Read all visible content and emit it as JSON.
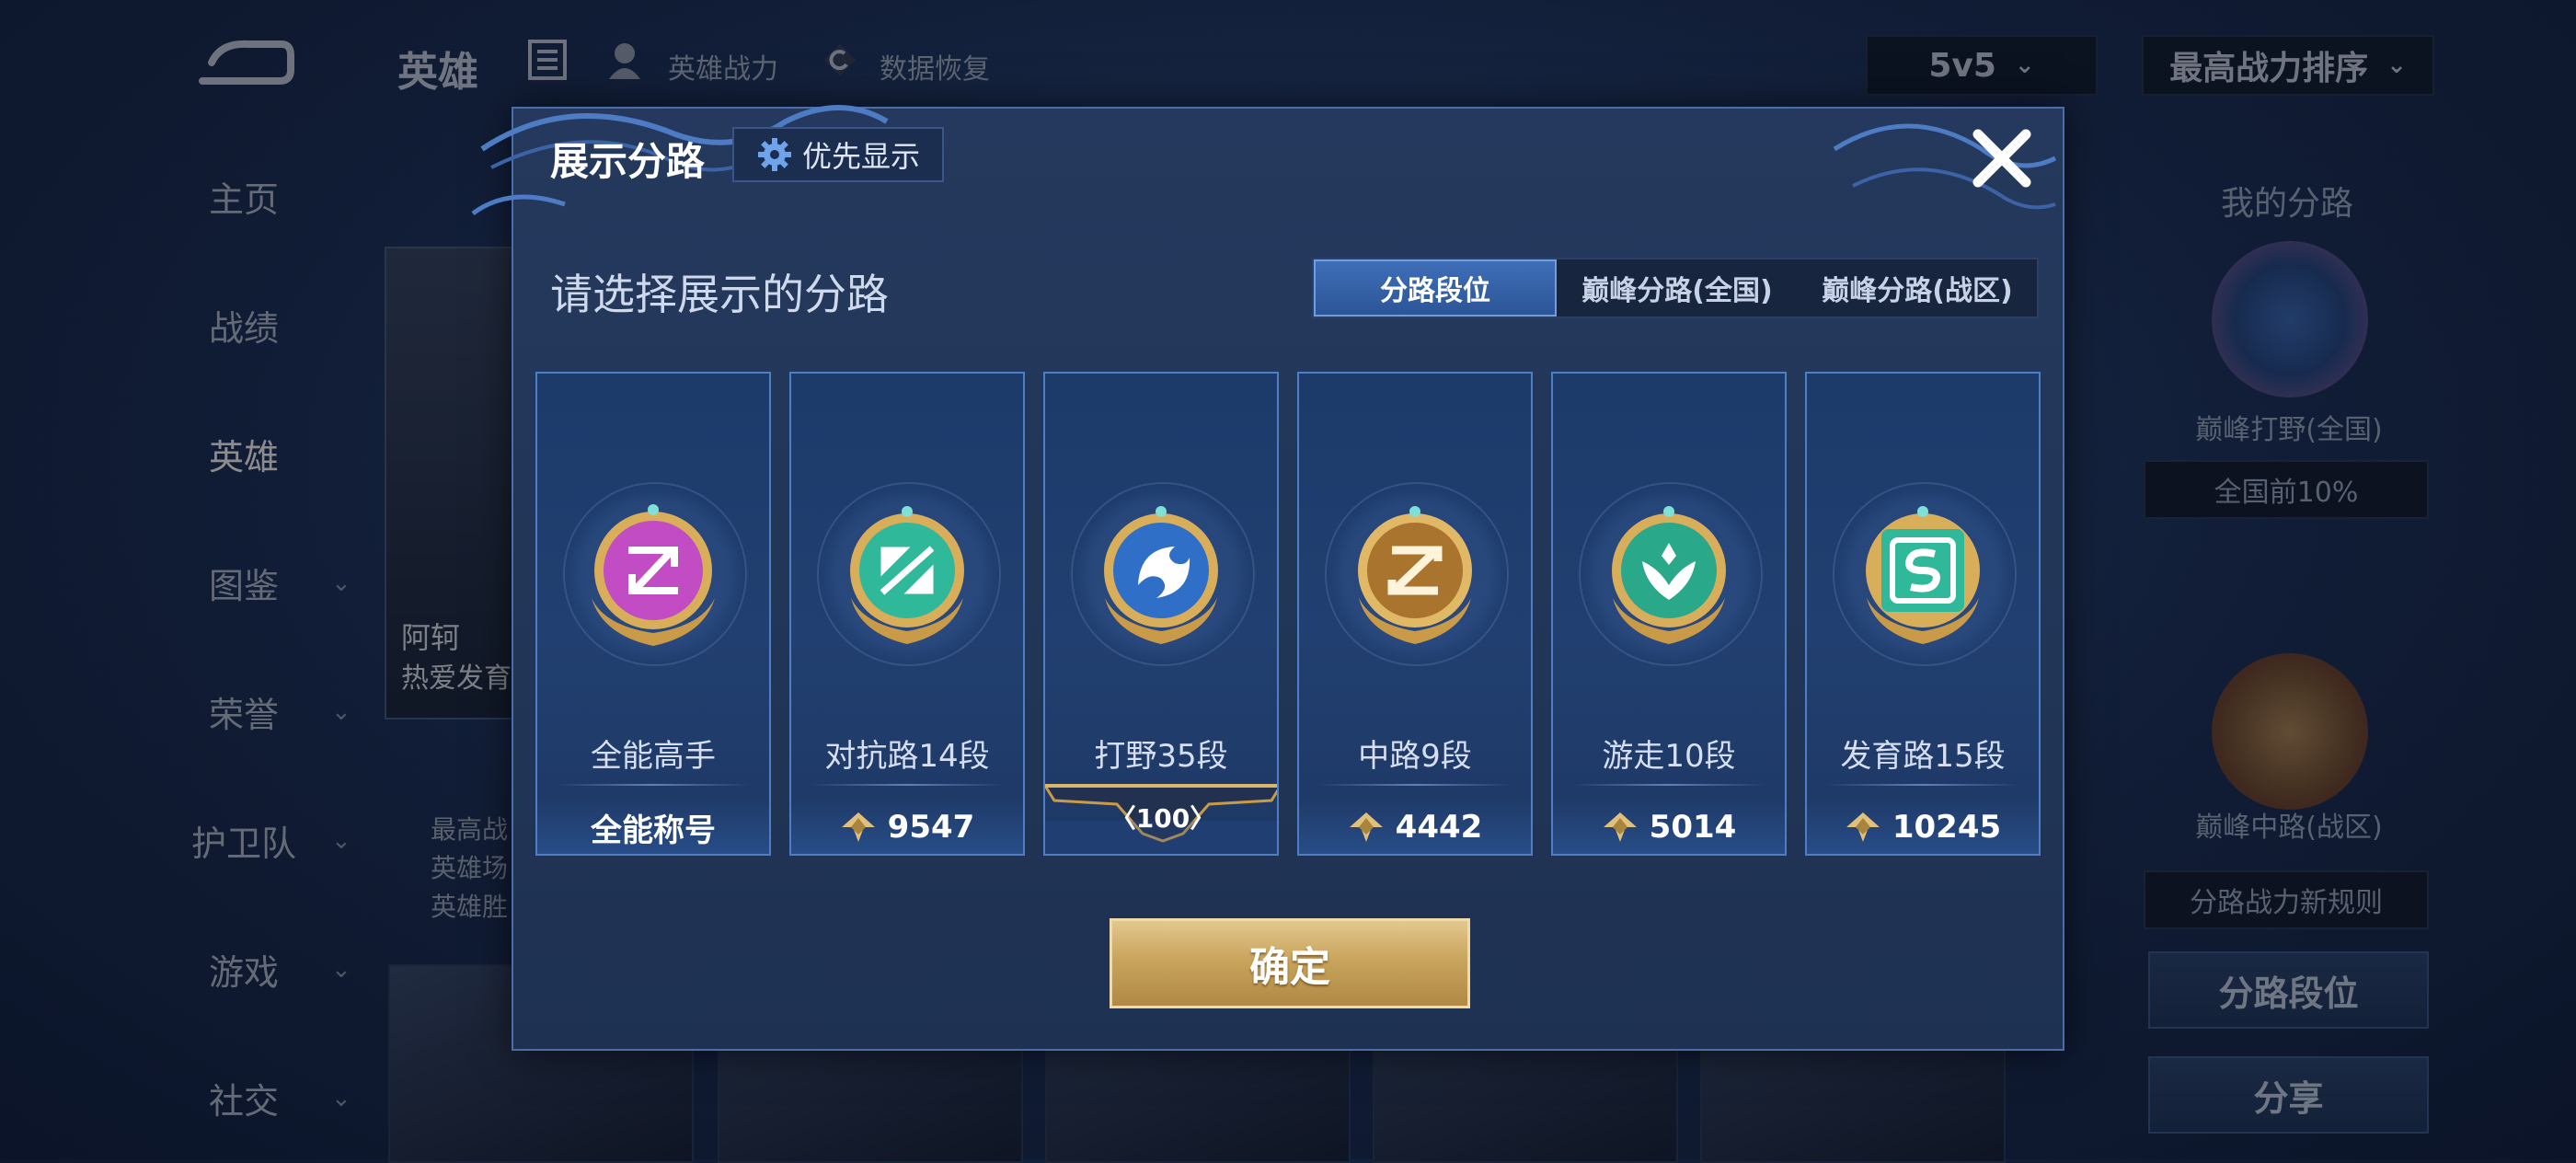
{
  "background": {
    "top_bar": {
      "title": "英雄",
      "links": [
        "英雄战力",
        "数据恢复"
      ],
      "mode_select": "5v5",
      "sort_select": "最高战力排序"
    },
    "sidebar": {
      "items": [
        {
          "label": "主页",
          "has_chevron": false
        },
        {
          "label": "战绩",
          "has_chevron": false
        },
        {
          "label": "英雄",
          "has_chevron": false,
          "active": true
        },
        {
          "label": "图鉴",
          "has_chevron": true
        },
        {
          "label": "荣誉",
          "has_chevron": true
        },
        {
          "label": "护卫队",
          "has_chevron": true
        },
        {
          "label": "游戏",
          "has_chevron": true
        },
        {
          "label": "社交",
          "has_chevron": true
        }
      ]
    },
    "hero_card": {
      "name_partial": "阿轲",
      "subtitle_partial": "热爱发育",
      "meta": [
        "最高战",
        "英雄场",
        "英雄胜"
      ]
    },
    "right_panel": {
      "title": "我的分路",
      "primary_label": "巅峰打野(全国)",
      "primary_rank": "全国前10%",
      "secondary_label": "巅峰中路(战区)",
      "rules_label": "分路战力新规则",
      "buttons": [
        "分路段位",
        "分享"
      ]
    }
  },
  "modal": {
    "title": "展示分路",
    "priority_button": "优先显示",
    "subtitle": "请选择展示的分路",
    "tabs": [
      {
        "label": "分路段位",
        "active": true
      },
      {
        "label": "巅峰分路(全国)",
        "active": false
      },
      {
        "label": "巅峰分路(战区)",
        "active": false
      }
    ],
    "cards": [
      {
        "name": "全能高手",
        "value": "全能称号",
        "icon": "all-round-icon",
        "color": "#c24cc4",
        "power": false
      },
      {
        "name": "对抗路14段",
        "value": "9547",
        "icon": "clash-lane-icon",
        "color": "#2fb89a",
        "power": true
      },
      {
        "name": "打野35段",
        "value": "100",
        "icon": "jungle-icon",
        "color": "#3f7fd6",
        "power": false,
        "badge": true
      },
      {
        "name": "中路9段",
        "value": "4442",
        "icon": "mid-lane-icon",
        "color": "#c8923a",
        "power": true
      },
      {
        "name": "游走10段",
        "value": "5014",
        "icon": "roam-icon",
        "color": "#2fb89a",
        "power": true
      },
      {
        "name": "发育路15段",
        "value": "10245",
        "icon": "farm-lane-icon",
        "color": "#2fb89a",
        "power": true
      }
    ],
    "confirm_button": "确定"
  }
}
